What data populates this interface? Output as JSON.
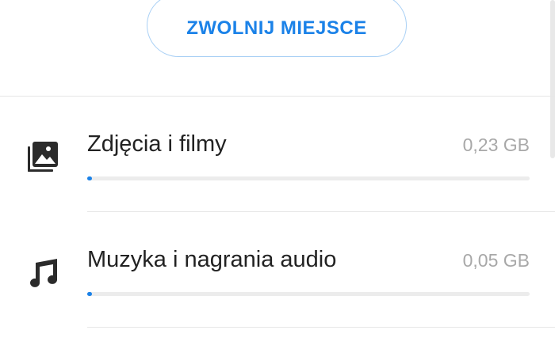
{
  "actions": {
    "free_space_label": "ZWOLNIJ MIEJSCE"
  },
  "storage": {
    "items": [
      {
        "label": "Zdjęcia i filmy",
        "size": "0,23 GB",
        "icon": "photo-library-icon",
        "usage_fraction": 0.01
      },
      {
        "label": "Muzyka i nagrania audio",
        "size": "0,05 GB",
        "icon": "music-note-icon",
        "usage_fraction": 0.01
      }
    ]
  },
  "colors": {
    "accent": "#1b82e8",
    "button_border": "#a9d0f5",
    "track": "#ececec",
    "secondary_text": "#a8a8a8"
  }
}
